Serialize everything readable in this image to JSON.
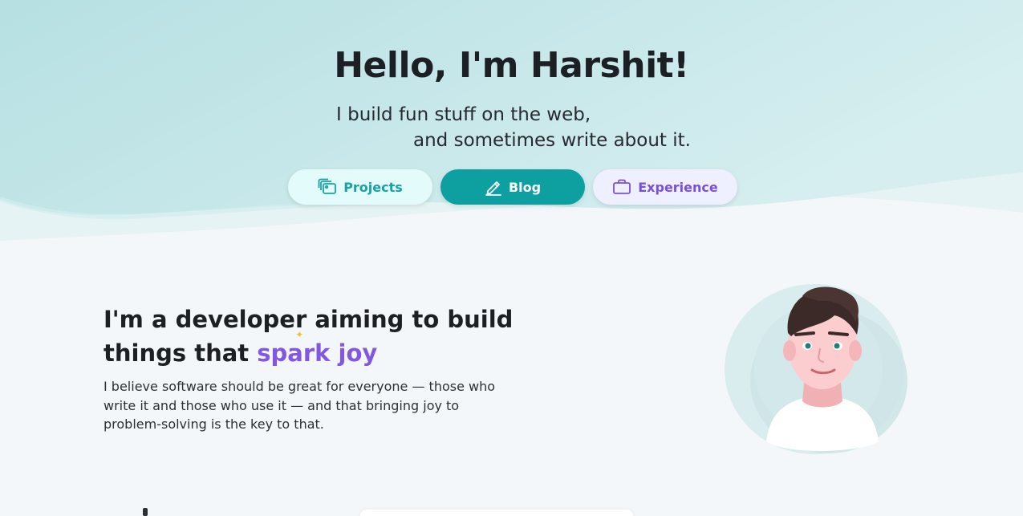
{
  "hero": {
    "title": "Hello, I'm Harshit!",
    "tagline_line1": "I build fun stuff on the web,",
    "tagline_line2": "and sometimes write about it."
  },
  "nav": [
    {
      "label": "Projects",
      "icon": "gallery-icon",
      "color": "#18a3a3",
      "background": "#e4fbfc"
    },
    {
      "label": "Blog",
      "icon": "pencil-icon",
      "color": "#ffffff",
      "background": "#0ea0a0"
    },
    {
      "label": "Experience",
      "icon": "briefcase-icon",
      "color": "#7a50d9",
      "background": "#eeefff"
    }
  ],
  "intro": {
    "heading_prefix": "I'm a developer aiming to build things that ",
    "heading_highlight": "spark joy",
    "body": "I believe software should be great for everyone — those who write it and those who use it — and that bringing joy to problem-solving is the key to that."
  },
  "colors": {
    "accent_teal": "#0ea0a0",
    "accent_purple": "#8258e0",
    "hero_background": "#c2e6e8",
    "page_background": "#f4f7f9"
  }
}
